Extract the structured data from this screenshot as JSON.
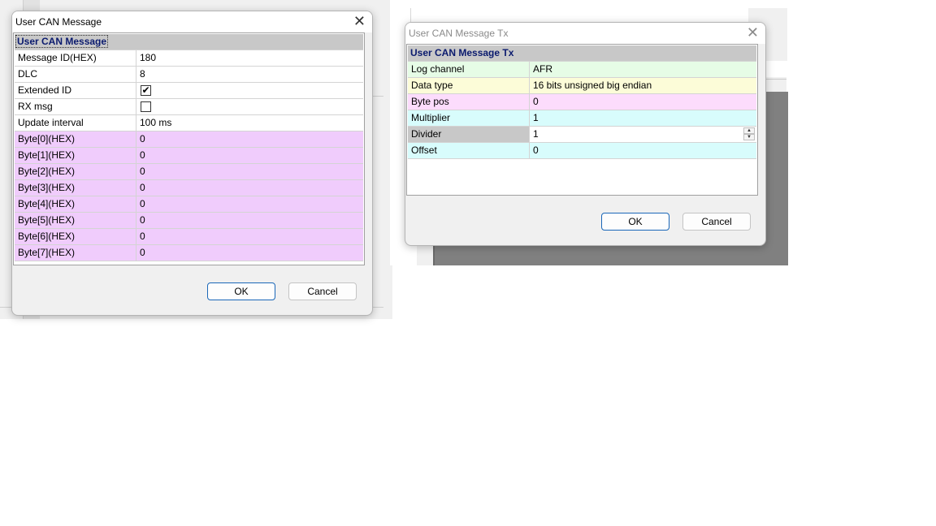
{
  "dialog1": {
    "title": "User CAN Message",
    "section": "User CAN Message",
    "rows": [
      {
        "label": "Message ID(HEX)",
        "value": "180",
        "color": "#ffffff"
      },
      {
        "label": "DLC",
        "value": "8",
        "color": "#ffffff"
      },
      {
        "label": "Extended ID",
        "value": "",
        "checked": true,
        "color": "#ffffff"
      },
      {
        "label": "RX msg",
        "value": "",
        "checked": false,
        "color": "#ffffff"
      },
      {
        "label": "Update interval",
        "value": "100 ms",
        "color": "#ffffff"
      },
      {
        "label": "Byte[0](HEX)",
        "value": "0",
        "color": "#f0ccfc"
      },
      {
        "label": "Byte[1](HEX)",
        "value": "0",
        "color": "#f0ccfc"
      },
      {
        "label": "Byte[2](HEX)",
        "value": "0",
        "color": "#f0ccfc"
      },
      {
        "label": "Byte[3](HEX)",
        "value": "0",
        "color": "#f0ccfc"
      },
      {
        "label": "Byte[4](HEX)",
        "value": "0",
        "color": "#f0ccfc"
      },
      {
        "label": "Byte[5](HEX)",
        "value": "0",
        "color": "#f0ccfc"
      },
      {
        "label": "Byte[6](HEX)",
        "value": "0",
        "color": "#f0ccfc"
      },
      {
        "label": "Byte[7](HEX)",
        "value": "0",
        "color": "#f0ccfc"
      }
    ],
    "ok_label": "OK",
    "cancel_label": "Cancel"
  },
  "dialog2": {
    "title": "User CAN Message Tx",
    "section": "User CAN Message Tx",
    "rows": [
      {
        "label": "Log channel",
        "value": "AFR",
        "color": "#e6fce6"
      },
      {
        "label": "Data type",
        "value": "16 bits unsigned big endian",
        "color": "#fcfcd8"
      },
      {
        "label": "Byte pos",
        "value": "0",
        "color": "#fcdcfc"
      },
      {
        "label": "Multiplier",
        "value": "1",
        "color": "#d8fcfc"
      },
      {
        "label": "Divider",
        "value": "1",
        "color": "#d8fcfc",
        "selected": true
      },
      {
        "label": "Offset",
        "value": "0",
        "color": "#d8fcfc"
      }
    ],
    "ok_label": "OK",
    "cancel_label": "Cancel"
  },
  "icons": {
    "close": "close-icon",
    "check": "checkmark-icon",
    "spin_up": "spin-up-icon",
    "spin_down": "spin-down-icon"
  }
}
